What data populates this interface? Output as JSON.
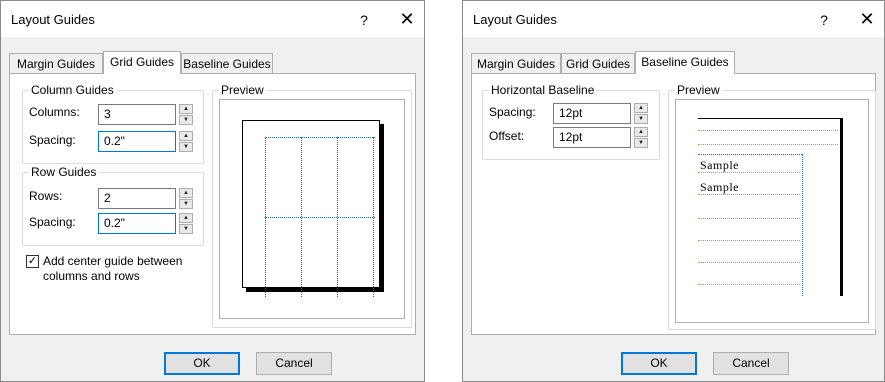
{
  "dialog1": {
    "title": "Layout Guides",
    "help": "?",
    "close": "✕",
    "tabs": [
      "Margin Guides",
      "Grid Guides",
      "Baseline Guides"
    ],
    "column_guides": {
      "legend": "Column Guides",
      "columns_label": "Columns:",
      "columns_value": "3",
      "spacing_label": "Spacing:",
      "spacing_value": "0.2\""
    },
    "row_guides": {
      "legend": "Row Guides",
      "rows_label": "Rows:",
      "rows_value": "2",
      "spacing_label": "Spacing:",
      "spacing_value": "0.2\""
    },
    "center_guide_label": "Add center guide between columns and rows",
    "center_guide_checked": true,
    "preview_legend": "Preview",
    "ok": "OK",
    "cancel": "Cancel"
  },
  "dialog2": {
    "title": "Layout Guides",
    "help": "?",
    "close": "✕",
    "tabs": [
      "Margin Guides",
      "Grid Guides",
      "Baseline Guides"
    ],
    "horizontal_baseline": {
      "legend": "Horizontal Baseline",
      "spacing_label": "Spacing:",
      "spacing_value": "12pt",
      "offset_label": "Offset:",
      "offset_value": "12pt"
    },
    "preview_legend": "Preview",
    "samples": [
      "Sample",
      "Sample"
    ],
    "ok": "OK",
    "cancel": "Cancel"
  },
  "colors": {
    "guide": "#1f6fc0",
    "baseline": "#c89a2a",
    "focus": "#0078d7"
  },
  "icons": {
    "spin_up": "up-arrow-icon",
    "spin_down": "down-arrow-icon",
    "check": "checkmark-icon"
  }
}
